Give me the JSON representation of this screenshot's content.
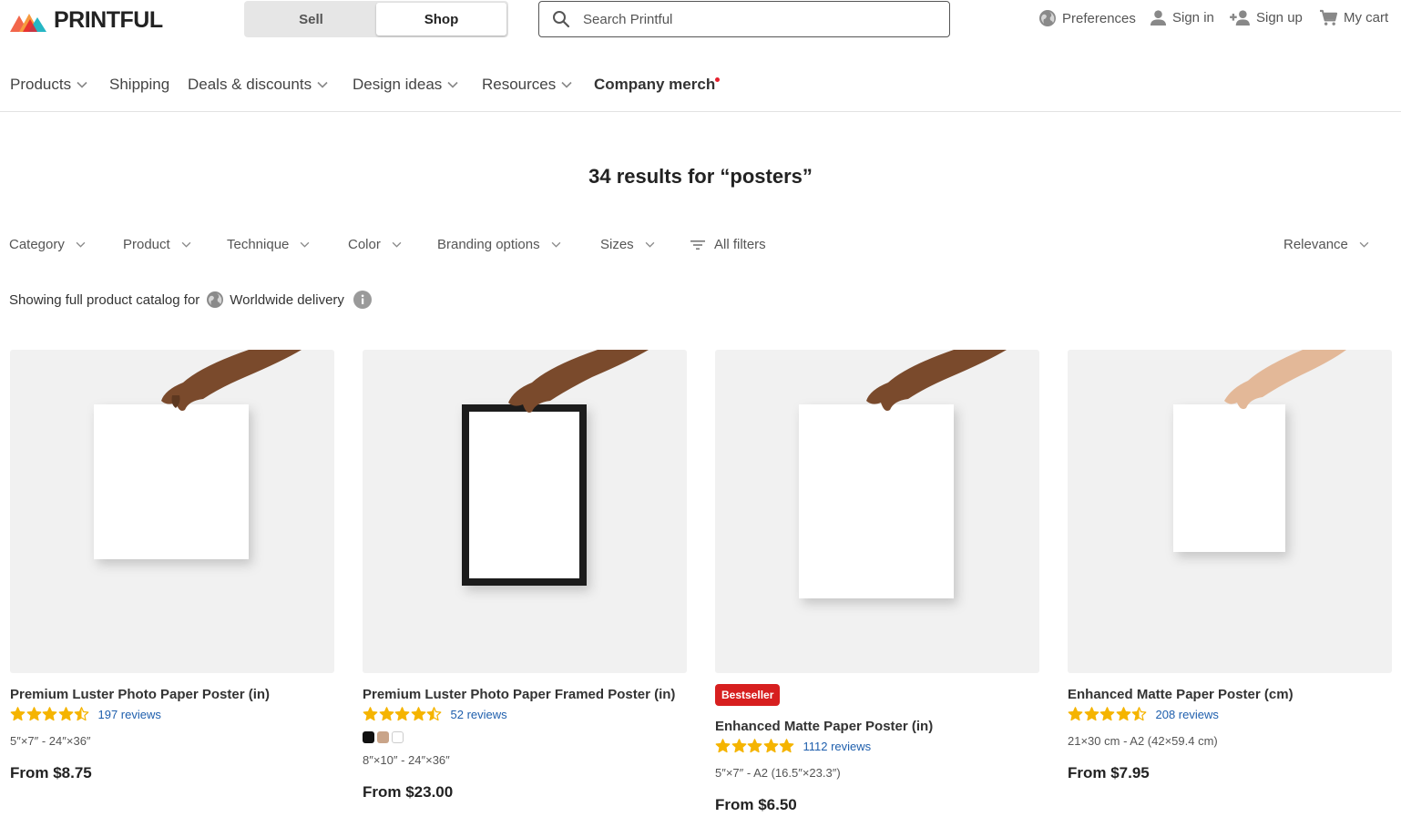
{
  "header": {
    "logo_text": "PRINTFUL",
    "toggle": {
      "sell": "Sell",
      "shop": "Shop",
      "active": "shop"
    },
    "search_placeholder": "Search Printful",
    "preferences": "Preferences",
    "sign_in": "Sign in",
    "sign_up": "Sign up",
    "cart": "My cart"
  },
  "nav": {
    "items": [
      {
        "label": "Products"
      },
      {
        "label": "Shipping"
      },
      {
        "label": "Deals & discounts"
      },
      {
        "label": "Design ideas"
      },
      {
        "label": "Resources"
      },
      {
        "label": "Company merch"
      }
    ]
  },
  "results_title": "34 results for “posters”",
  "filters": {
    "category": "Category",
    "product": "Product",
    "technique": "Technique",
    "color": "Color",
    "branding": "Branding options",
    "sizes": "Sizes",
    "all_filters": "All filters",
    "sort": "Relevance"
  },
  "catalog_note": {
    "prefix": "Showing full product catalog for",
    "region": "Worldwide delivery"
  },
  "products": [
    {
      "title": "Premium Luster Photo Paper Poster (in)",
      "rating": 4.5,
      "reviews": "197 reviews",
      "sizes": "5″×7″ - 24″×36″",
      "price": "From $8.75"
    },
    {
      "title": "Premium Luster Photo Paper Framed Poster (in)",
      "rating": 4.5,
      "reviews": "52 reviews",
      "swatches": [
        "#111111",
        "#c9a489",
        "#ffffff"
      ],
      "sizes": "8″×10″ - 24″×36″",
      "price": "From $23.00"
    },
    {
      "badge": "Bestseller",
      "title": "Enhanced Matte Paper Poster (in)",
      "rating": 5,
      "reviews": "1112 reviews",
      "sizes": "5″×7″ - A2 (16.5″×23.3″)",
      "price": "From $6.50"
    },
    {
      "title": "Enhanced Matte Paper Poster (cm)",
      "rating": 4.5,
      "reviews": "208 reviews",
      "sizes": "21×30 cm - A2 (42×59.4 cm)",
      "price": "From $7.95"
    }
  ],
  "colors": {
    "star": "#f5b400",
    "link": "#1f5fad",
    "badge": "#d71f1f",
    "image_bg": "#f1f1f1"
  }
}
